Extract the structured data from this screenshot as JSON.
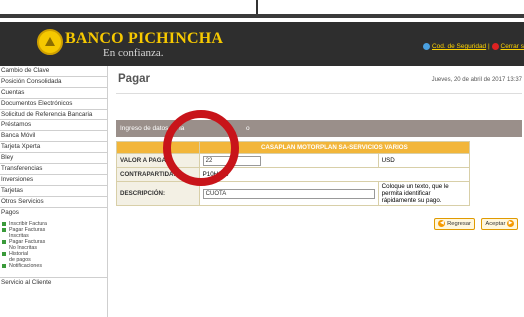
{
  "header": {
    "brand": "BANCO PICHINCHA",
    "tagline": "En confianza.",
    "security_code_link": "Cod. de Seguridad",
    "separator": "|",
    "logout_link": "Cerrar s"
  },
  "sidebar": {
    "items": [
      {
        "label": "Cambio de Clave"
      },
      {
        "label": "Posición Consolidada"
      },
      {
        "label": "Cuentas"
      },
      {
        "label": "Documentos Electrónicos"
      },
      {
        "label": "Solicitud de Referencia Bancaria"
      },
      {
        "label": "Préstamos"
      },
      {
        "label": "Banca Móvil"
      },
      {
        "label": "Tarjeta Xperta"
      },
      {
        "label": "Bley"
      },
      {
        "label": "Transferencias"
      },
      {
        "label": "Inversiones"
      },
      {
        "label": "Tarjetas"
      },
      {
        "label": "Otros Servicios"
      },
      {
        "label": "Pagos"
      }
    ],
    "pagos_sub": [
      {
        "label": "Inscribir Factura"
      },
      {
        "label": "Pagar Facturas",
        "label2": "Inscritas"
      },
      {
        "label": "Pagar Facturas",
        "label2": "No Inscritas"
      },
      {
        "label": "Historial",
        "label2": "de pagos"
      },
      {
        "label": "Notificaciones"
      }
    ],
    "last_item": "Servicio al Cliente"
  },
  "main": {
    "title": "Pagar",
    "date": "Jueves, 20 de abril de 2017 13:37",
    "section_header_left": "Ingreso de datos de la",
    "section_header_right": "o"
  },
  "form": {
    "service_header": "CASAPLAN MOTORPLAN SA-SERVICIOS VARIOS",
    "amount_label": "VALOR A PAGAR:",
    "amount_value": "22",
    "currency": "USD",
    "counterpart_label": "CONTRAPARTIDA:",
    "counterpart_value": "P10H003",
    "description_label": "DESCRIPCIÓN:",
    "description_value": "CUOTA",
    "description_hint": "Coloque un texto, que le permita identificar rápidamente su pago."
  },
  "buttons": {
    "back": "Regresar",
    "accept": "Aceptar"
  },
  "colors": {
    "header_bg": "#2e2e2e",
    "brand_yellow": "#f7c900",
    "table_header": "#f2b63a",
    "annotation_red": "#c8141a"
  }
}
